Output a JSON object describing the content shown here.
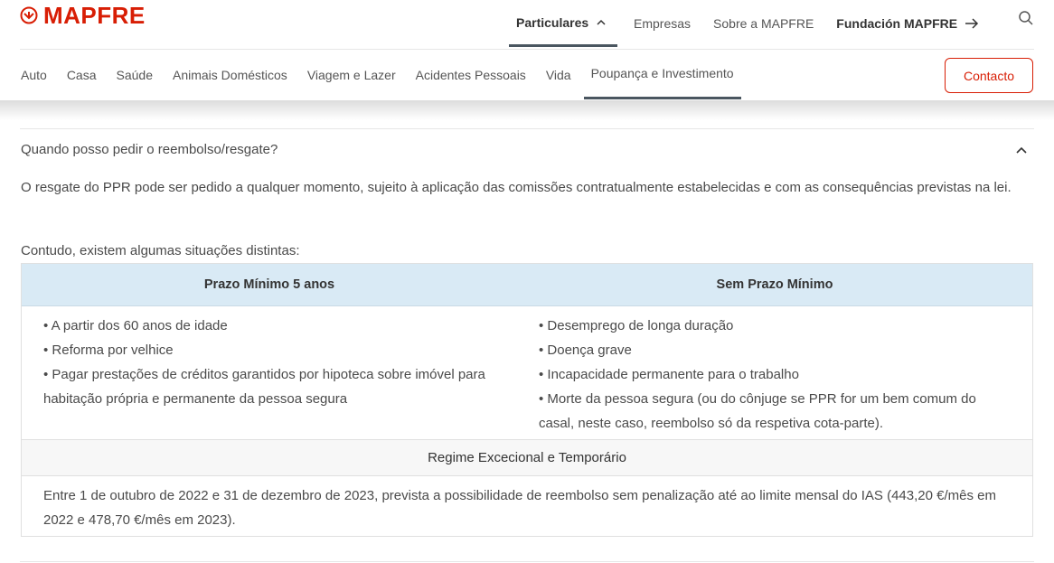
{
  "brand": {
    "name": "MAPFRE",
    "color": "#d81e05"
  },
  "top_nav": {
    "particulares": "Particulares",
    "empresas": "Empresas",
    "sobre": "Sobre a MAPFRE",
    "fundacion": "Fundación MAPFRE"
  },
  "icons": {
    "search": "search-icon",
    "chevron": "chevron-up-icon",
    "arrow": "arrow-right-icon"
  },
  "sub_nav": [
    "Auto",
    "Casa",
    "Saúde",
    "Animais Domésticos",
    "Viagem e Lazer",
    "Acidentes Pessoais",
    "Vida",
    "Poupança e Investimento"
  ],
  "contact_label": "Contacto",
  "faq": {
    "question": "Quando posso pedir o reembolso/resgate?",
    "answer_p1": "O resgate do PPR pode ser pedido a qualquer momento, sujeito à aplicação das comissões contratualmente estabelecidas e com as consequências previstas na lei.",
    "answer_p2": "Contudo, existem algumas situações distintas:",
    "table": {
      "col1_header": "Prazo Mínimo 5 anos",
      "col2_header": "Sem Prazo Mínimo",
      "col1_items": [
        "• A partir dos 60 anos de idade",
        "• Reforma por velhice",
        "• Pagar prestações de créditos garantidos por hipoteca sobre imóvel para habitação própria e permanente da pessoa segura"
      ],
      "col2_items": [
        "• Desemprego de longa duração",
        "• Doença grave",
        "• Incapacidade permanente para o trabalho",
        "• Morte da pessoa segura (ou do cônjuge se PPR for um bem comum do casal, neste caso, reembolso só da respetiva cota-parte)."
      ],
      "regime_header": "Regime Excecional e Temporário",
      "regime_text": "Entre 1 de outubro de 2022 e 31 de dezembro de 2023, prevista a possibilidade de reembolso sem penalização até ao limite mensal do IAS (443,20 €/mês em 2022 e 478,70 €/mês em 2023)."
    }
  }
}
